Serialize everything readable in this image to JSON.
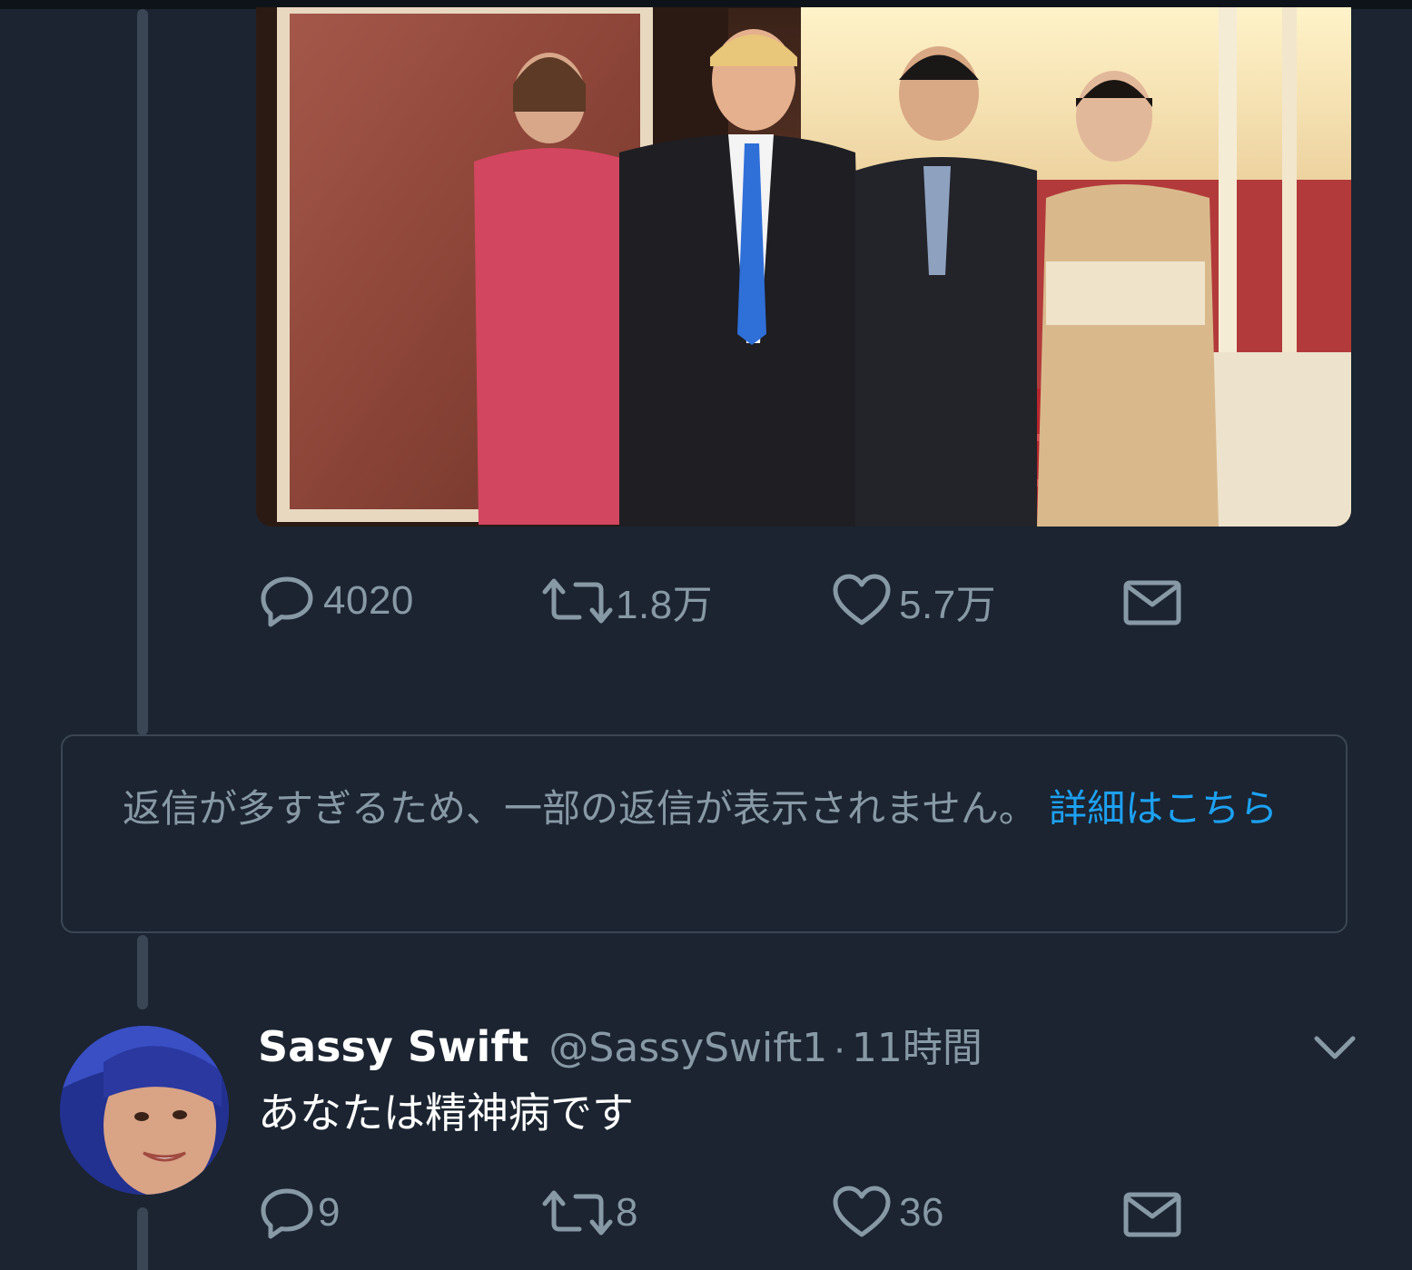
{
  "main_tweet": {
    "actions": {
      "reply_count": "4020",
      "retweet_count": "1.8万",
      "like_count": "5.7万"
    }
  },
  "notice": {
    "text": "返信が多すぎるため、一部の返信が表示されません。",
    "link_text": "詳細はこちら"
  },
  "reply": {
    "display_name": "Sassy Swift",
    "handle": "@SassySwift1",
    "separator": "·",
    "time": "11時間",
    "text": "あなたは精神病です",
    "actions": {
      "reply_count": "9",
      "retweet_count": "8",
      "like_count": "36"
    }
  },
  "icons": {
    "reply": "reply-bubble-icon",
    "retweet": "retweet-icon",
    "like": "heart-icon",
    "dm": "envelope-icon",
    "more": "chevron-down-icon"
  },
  "colors": {
    "background": "#1b2430",
    "muted_text": "#8899a6",
    "link": "#1da1f2",
    "thread_line": "#3b4654"
  }
}
